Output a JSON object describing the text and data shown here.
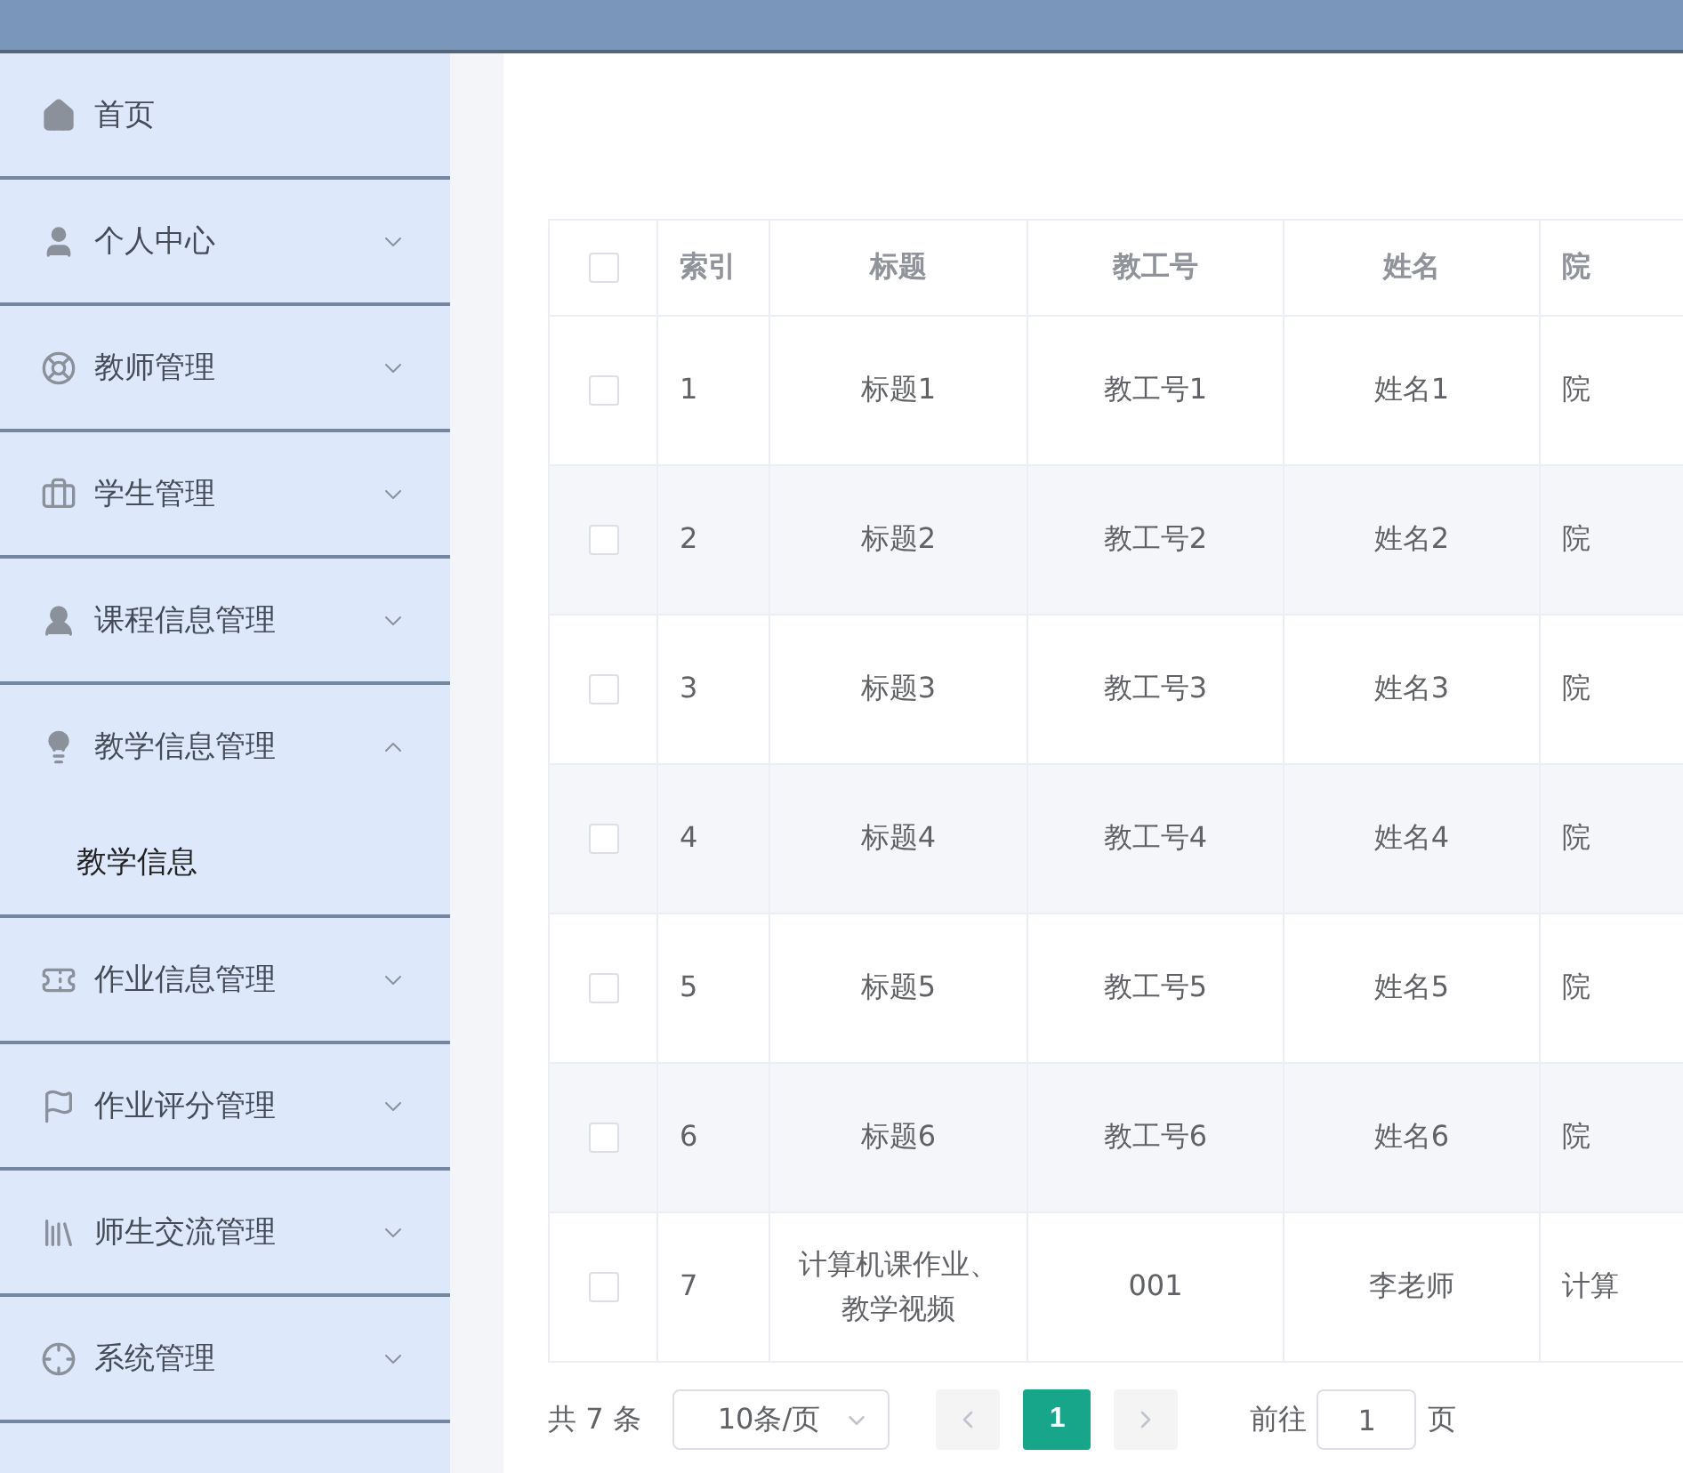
{
  "sidebar": {
    "items": [
      {
        "label": "首页",
        "has_arrow": false,
        "expanded": false
      },
      {
        "label": "个人中心",
        "has_arrow": true,
        "expanded": false
      },
      {
        "label": "教师管理",
        "has_arrow": true,
        "expanded": false
      },
      {
        "label": "学生管理",
        "has_arrow": true,
        "expanded": false
      },
      {
        "label": "课程信息管理",
        "has_arrow": true,
        "expanded": false
      },
      {
        "label": "教学信息管理",
        "has_arrow": true,
        "expanded": true,
        "children": [
          {
            "label": "教学信息"
          }
        ]
      },
      {
        "label": "作业信息管理",
        "has_arrow": true,
        "expanded": false
      },
      {
        "label": "作业评分管理",
        "has_arrow": true,
        "expanded": false
      },
      {
        "label": "师生交流管理",
        "has_arrow": true,
        "expanded": false
      },
      {
        "label": "系统管理",
        "has_arrow": true,
        "expanded": false
      }
    ]
  },
  "table": {
    "select_all_checked": false,
    "columns": [
      "索引",
      "标题",
      "教工号",
      "姓名",
      "院"
    ],
    "rows": [
      {
        "checked": false,
        "cells": [
          "1",
          "标题1",
          "教工号1",
          "姓名1",
          "院"
        ]
      },
      {
        "checked": false,
        "cells": [
          "2",
          "标题2",
          "教工号2",
          "姓名2",
          "院"
        ]
      },
      {
        "checked": false,
        "cells": [
          "3",
          "标题3",
          "教工号3",
          "姓名3",
          "院"
        ]
      },
      {
        "checked": false,
        "cells": [
          "4",
          "标题4",
          "教工号4",
          "姓名4",
          "院"
        ]
      },
      {
        "checked": false,
        "cells": [
          "5",
          "标题5",
          "教工号5",
          "姓名5",
          "院"
        ]
      },
      {
        "checked": false,
        "cells": [
          "6",
          "标题6",
          "教工号6",
          "姓名6",
          "院"
        ]
      },
      {
        "checked": false,
        "cells": [
          "7",
          "计算机课作业、教学视频",
          "001",
          "李老师",
          "计算"
        ]
      }
    ]
  },
  "pagination": {
    "total": "共 7 条",
    "page_size": "10条/页",
    "prev_disabled": true,
    "next_disabled": true,
    "pages": [
      {
        "label": "1",
        "selected": true
      }
    ],
    "goto_label": "前往",
    "goto_value": "1",
    "goto_suffix": "页"
  }
}
